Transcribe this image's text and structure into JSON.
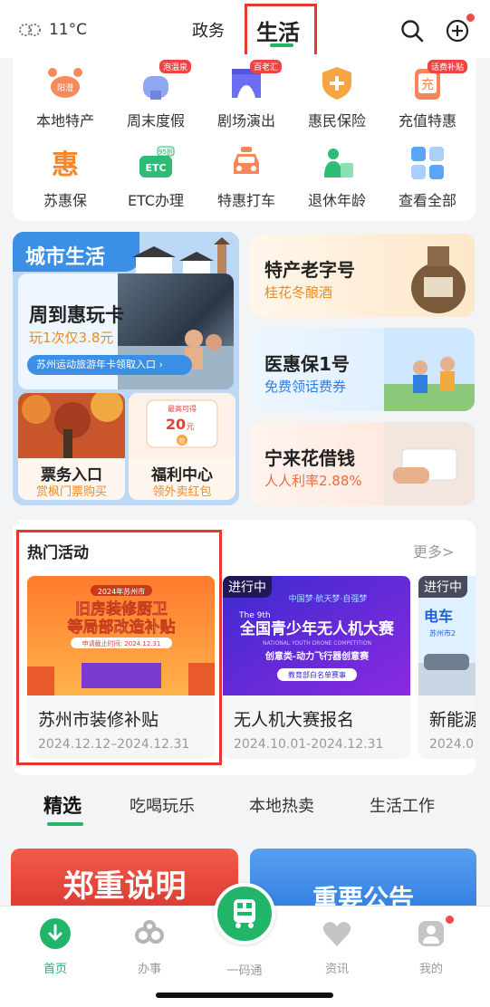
{
  "header": {
    "temperature": "11°C",
    "tabs": [
      "政务",
      "生活"
    ],
    "active_tab": "生活"
  },
  "services": [
    {
      "label": "本地特产",
      "icon": "crab-icon",
      "badge": ""
    },
    {
      "label": "周末度假",
      "icon": "mailbox-icon",
      "badge": "泡温泉"
    },
    {
      "label": "剧场演出",
      "icon": "theater-icon",
      "badge": "百老汇"
    },
    {
      "label": "惠民保险",
      "icon": "shield-plus-icon",
      "badge": ""
    },
    {
      "label": "充值特惠",
      "icon": "phone-charge-icon",
      "badge": "话费补贴"
    },
    {
      "label": "苏惠保",
      "icon": "hui-icon",
      "badge": ""
    },
    {
      "label": "ETC办理",
      "icon": "etc-icon",
      "badge": ""
    },
    {
      "label": "特惠打车",
      "icon": "taxi-icon",
      "badge": ""
    },
    {
      "label": "退休年龄",
      "icon": "retire-icon",
      "badge": ""
    },
    {
      "label": "查看全部",
      "icon": "grid-all-icon",
      "badge": ""
    }
  ],
  "icon_text": {
    "crab": "阳澄",
    "charge": "充",
    "hui": "惠",
    "etc": "ETC",
    "etc_discount": "95折"
  },
  "city_life": {
    "title": "城市生活",
    "week_card": {
      "title": "周到惠玩卡",
      "subtitle": "玩1次仅3.8元",
      "pill": "苏州运动旅游年卡领取入口 ›"
    },
    "ticket": {
      "title": "票务入口",
      "subtitle": "赏枫门票购买"
    },
    "welfare": {
      "title": "福利中心",
      "subtitle": "领外卖红包",
      "coupon_label": "最高可得",
      "coupon_value": "20",
      "coupon_unit": "元",
      "coupon_btn": "抢"
    }
  },
  "promos": [
    {
      "title": "特产老字号",
      "subtitle": "桂花冬酿酒"
    },
    {
      "title": "医惠保1号",
      "subtitle": "免费领话费券"
    },
    {
      "title": "宁来花借钱",
      "subtitle": "人人利率2.88%"
    }
  ],
  "hot": {
    "title": "热门活动",
    "more": "更多>",
    "items": [
      {
        "name": "苏州市装修补贴",
        "date": "2024.12.12–2024.12.31",
        "badge": "",
        "img_top": "2024年苏州市",
        "img_main1": "旧房装修厨卫",
        "img_main2": "等局部改造补贴",
        "img_small": "申请截止时间: 2024.12.31"
      },
      {
        "name": "无人机大赛报名",
        "date": "2024.10.01-2024.12.31",
        "badge": "进行中",
        "img_top": "中国梦·航天梦·自强梦",
        "img_year": "The 9th",
        "img_main": "全国青少年无人机大赛",
        "img_en": "NATIONAL YOUTH DRONE COMPETITION",
        "img_sub": "创意类-动力飞行器创意赛",
        "img_small": "教育部白名单赛事"
      },
      {
        "name": "新能源",
        "date": "2024.0",
        "badge": "进行中",
        "img_main": "电车",
        "img_sub": "苏州市2"
      }
    ]
  },
  "categories": [
    "精选",
    "吃喝玩乐",
    "本地热卖",
    "生活工作"
  ],
  "banners": [
    "郑重说明",
    "重要公告"
  ],
  "bottom_nav": [
    {
      "label": "首页",
      "icon": "home-download-icon"
    },
    {
      "label": "办事",
      "icon": "affairs-icon"
    },
    {
      "label": "一码通",
      "icon": "qr-code-icon"
    },
    {
      "label": "资讯",
      "icon": "news-heart-icon"
    },
    {
      "label": "我的",
      "icon": "profile-icon"
    }
  ],
  "colors": {
    "accent": "#21b56a",
    "highlight_box": "#e23a30",
    "orange_text": "#f08a1f"
  }
}
